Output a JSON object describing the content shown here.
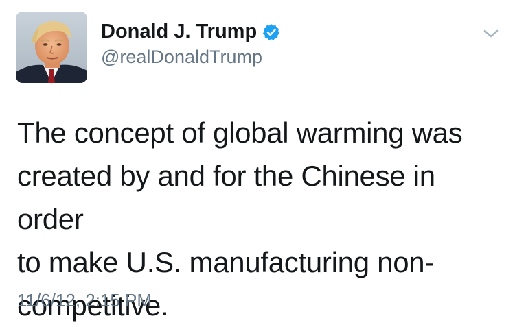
{
  "author": {
    "display_name": "Donald J. Trump",
    "handle": "@realDonaldTrump",
    "verified": true,
    "avatar_icon": "profile-photo"
  },
  "tweet": {
    "text": "The concept of global warming was\ncreated by and for the Chinese in order\nto make U.S. manufacturing non-\ncompetitive.",
    "timestamp": "11/6/12, 2:15 PM"
  },
  "icons": {
    "verified": "verified-badge-icon",
    "menu": "chevron-down-icon"
  },
  "colors": {
    "verified_blue": "#1da1f2",
    "secondary_text": "#657786",
    "primary_text": "#14171a"
  }
}
